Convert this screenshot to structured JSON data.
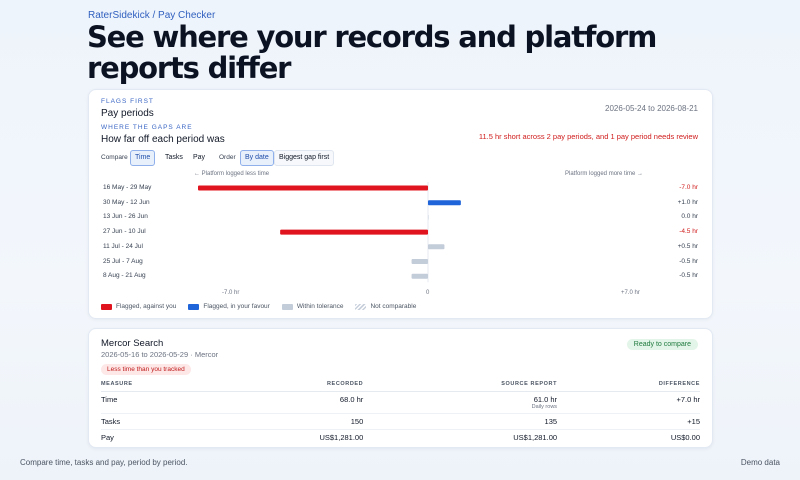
{
  "breadcrumb": "RaterSidekick / Pay Checker",
  "hero_title": "See where your records and platform reports differ",
  "periods_card": {
    "eyebrow": "FLAGS FIRST",
    "title": "Pay periods",
    "date_range": "2026-05-24 to 2026-08-21",
    "gaps_eyebrow": "WHERE THE GAPS ARE",
    "gaps_title": "How far off each period was",
    "gap_summary": "11.5 hr short across 2 pay periods, and 1 pay period needs review",
    "compare_label": "Compare",
    "compare_options": [
      "Time",
      "Tasks",
      "Pay"
    ],
    "compare_selected": "Time",
    "order_label": "Order",
    "order_options": [
      "By date",
      "Biggest gap first"
    ],
    "order_selected": "By date"
  },
  "chart_data": {
    "type": "bar",
    "orientation": "horizontal-diverging",
    "left_note": "← Platform logged less time",
    "right_note": "Platform logged more time →",
    "xlim": [
      -7.0,
      7.0
    ],
    "ticks": [
      "-7.0 hr",
      "0",
      "+7.0 hr"
    ],
    "categories": [
      "16 May - 29 May",
      "30 May - 12 Jun",
      "13 Jun - 26 Jun",
      "27 Jun - 10 Jul",
      "11 Jul - 24 Jul",
      "25 Jul - 7 Aug",
      "8 Aug - 21 Aug"
    ],
    "values": [
      -7.0,
      1.0,
      0.0,
      -4.5,
      0.5,
      -0.5,
      -0.5
    ],
    "value_labels": [
      "-7.0 hr",
      "+1.0 hr",
      "0.0 hr",
      "-4.5 hr",
      "+0.5 hr",
      "-0.5 hr",
      "-0.5 hr"
    ],
    "status": [
      "against",
      "favour",
      "within",
      "against",
      "within",
      "within",
      "within"
    ],
    "legend": [
      {
        "key": "against",
        "label": "Flagged, against you",
        "color": "#e0141e"
      },
      {
        "key": "favour",
        "label": "Flagged, in your favour",
        "color": "#1f64d8"
      },
      {
        "key": "within",
        "label": "Within tolerance",
        "color": "#c3ccd9"
      },
      {
        "key": "na",
        "label": "Not comparable",
        "color": "hatch"
      }
    ]
  },
  "detail_card": {
    "title": "Mercor Search",
    "subtitle": "2026-05-16 to 2026-05-29 · Mercor",
    "status_badge": "Ready to compare",
    "warning_badge": "Less time than you tracked",
    "columns": [
      "MEASURE",
      "RECORDED",
      "SOURCE REPORT",
      "DIFFERENCE"
    ],
    "rows": [
      {
        "measure": "Time",
        "recorded": "68.0 hr",
        "source": "61.0 hr",
        "source_note": "Daily rows",
        "difference": "+7.0 hr"
      },
      {
        "measure": "Tasks",
        "recorded": "150",
        "source": "135",
        "source_note": "",
        "difference": "+15"
      },
      {
        "measure": "Pay",
        "recorded": "US$1,281.00",
        "source": "US$1,281.00",
        "source_note": "",
        "difference": "US$0.00"
      }
    ]
  },
  "footer": {
    "left": "Compare time, tasks and pay, period by period.",
    "right": "Demo data"
  }
}
